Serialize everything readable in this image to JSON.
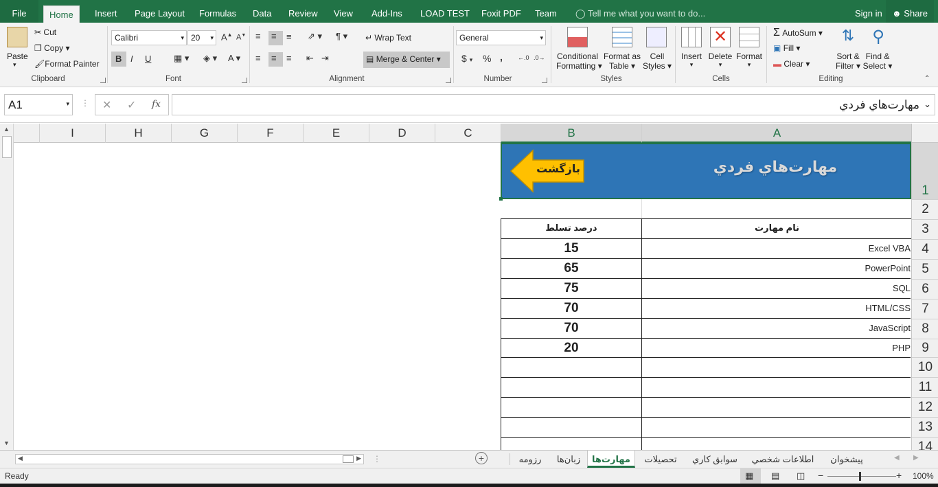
{
  "tabs": {
    "file": "File",
    "home": "Home",
    "insert": "Insert",
    "page_layout": "Page Layout",
    "formulas": "Formulas",
    "data": "Data",
    "review": "Review",
    "view": "View",
    "addins": "Add-Ins",
    "load_test": "LOAD TEST",
    "foxit": "Foxit PDF",
    "team": "Team",
    "tell_me": "Tell me what you want to do...",
    "sign_in": "Sign in",
    "share": "Share"
  },
  "ribbon": {
    "clipboard": {
      "paste": "Paste",
      "cut": "Cut",
      "copy": "Copy",
      "format_painter": "Format Painter",
      "label": "Clipboard"
    },
    "font": {
      "name": "Calibri",
      "size": "20",
      "bold": "B",
      "italic": "I",
      "underline": "U",
      "label": "Font"
    },
    "alignment": {
      "wrap_text": "Wrap Text",
      "merge_center": "Merge & Center",
      "label": "Alignment"
    },
    "number": {
      "format": "General",
      "currency": "$",
      "percent": "%",
      "comma": ",",
      "label": "Number"
    },
    "styles": {
      "conditional_1": "Conditional",
      "conditional_2": "Formatting",
      "format_table_1": "Format as",
      "format_table_2": "Table",
      "cell_styles_1": "Cell",
      "cell_styles_2": "Styles",
      "label": "Styles"
    },
    "cells": {
      "insert": "Insert",
      "delete": "Delete",
      "format": "Format",
      "label": "Cells"
    },
    "editing": {
      "autosum": "AutoSum",
      "fill": "Fill",
      "clear": "Clear",
      "sort_1": "Sort &",
      "sort_2": "Filter",
      "find_1": "Find &",
      "find_2": "Select",
      "label": "Editing"
    }
  },
  "formula_bar": {
    "name_box": "A1",
    "fx": "fx",
    "content": "مهارت‌هاي فردي"
  },
  "columns": [
    {
      "letter": "I"
    },
    {
      "letter": "H"
    },
    {
      "letter": "G"
    },
    {
      "letter": "F"
    },
    {
      "letter": "E"
    },
    {
      "letter": "D"
    },
    {
      "letter": "C"
    },
    {
      "letter": "B"
    },
    {
      "letter": "A"
    }
  ],
  "rows": [
    "1",
    "2",
    "3",
    "4",
    "5",
    "6",
    "7",
    "8",
    "9",
    "10",
    "11",
    "12",
    "13",
    "14"
  ],
  "sheet": {
    "title": "مهارت‌هاي فردي",
    "back_button": "بازگشت",
    "header_skill": "نام مهارت",
    "header_percent": "درصد تسلط",
    "skills": [
      {
        "name": "Excel VBA",
        "percent": "15"
      },
      {
        "name": "PowerPoint",
        "percent": "65"
      },
      {
        "name": "SQL",
        "percent": "75"
      },
      {
        "name": "HTML/CSS",
        "percent": "70"
      },
      {
        "name": "JavaScript",
        "percent": "70"
      },
      {
        "name": "PHP",
        "percent": "20"
      }
    ]
  },
  "sheet_tabs": [
    "پيشخوان",
    "اطلاعات شخصي",
    "سوابق كاري",
    "تحصيلات",
    "مهارت‌ها",
    "زبان‌ها",
    "رزومه"
  ],
  "active_sheet_tab": "مهارت‌ها",
  "status": {
    "ready": "Ready",
    "zoom": "100%"
  },
  "colors": {
    "accent": "#217346",
    "banner": "#2e75b6",
    "arrow": "#ffc000"
  }
}
